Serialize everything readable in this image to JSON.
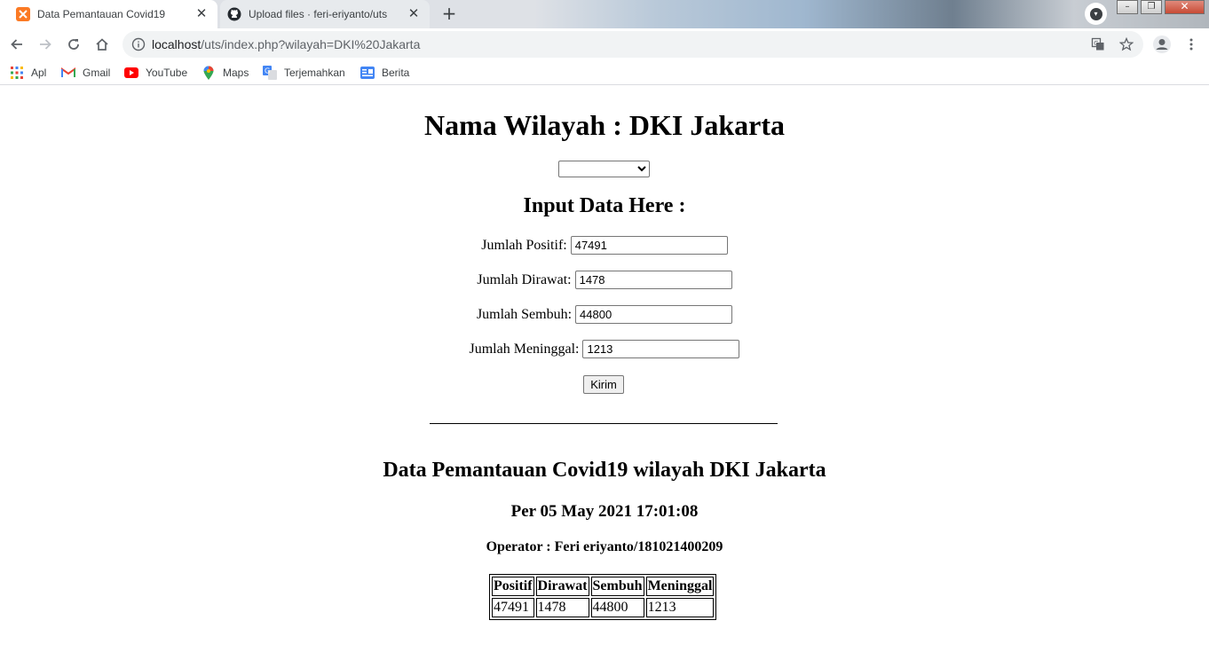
{
  "browser": {
    "tabs": [
      {
        "title": "Data Pemantauan Covid19",
        "favicon": "xampp-icon",
        "active": true
      },
      {
        "title": "Upload files · feri-eriyanto/uts",
        "favicon": "github-icon",
        "active": false
      }
    ],
    "new_tab_label": "+",
    "url_host": "localhost",
    "url_path": "/uts/index.php?wilayah=DKI%20Jakarta",
    "bookmarks": [
      {
        "label": "Apl",
        "icon": "apps-grid-icon"
      },
      {
        "label": "Gmail",
        "icon": "gmail-icon"
      },
      {
        "label": "YouTube",
        "icon": "youtube-icon"
      },
      {
        "label": "Maps",
        "icon": "maps-pin-icon"
      },
      {
        "label": "Terjemahkan",
        "icon": "translate-icon"
      },
      {
        "label": "Berita",
        "icon": "news-icon"
      }
    ]
  },
  "page": {
    "title": "Nama Wilayah : DKI Jakarta",
    "region_select_value": "",
    "form_heading": "Input Data Here :",
    "fields": {
      "positif": {
        "label": "Jumlah Positif:",
        "value": "47491"
      },
      "dirawat": {
        "label": "Jumlah Dirawat:",
        "value": "1478"
      },
      "sembuh": {
        "label": "Jumlah Sembuh:",
        "value": "44800"
      },
      "meninggal": {
        "label": "Jumlah Meninggal:",
        "value": "1213"
      }
    },
    "submit_label": "Kirim",
    "report_heading": "Data Pemantauan Covid19 wilayah DKI Jakarta",
    "report_date": "Per 05 May 2021 17:01:08",
    "operator": "Operator : Feri eriyanto/181021400209",
    "table": {
      "headers": [
        "Positif",
        "Dirawat",
        "Sembuh",
        "Meninggal"
      ],
      "row": [
        "47491",
        "1478",
        "44800",
        "1213"
      ]
    }
  }
}
